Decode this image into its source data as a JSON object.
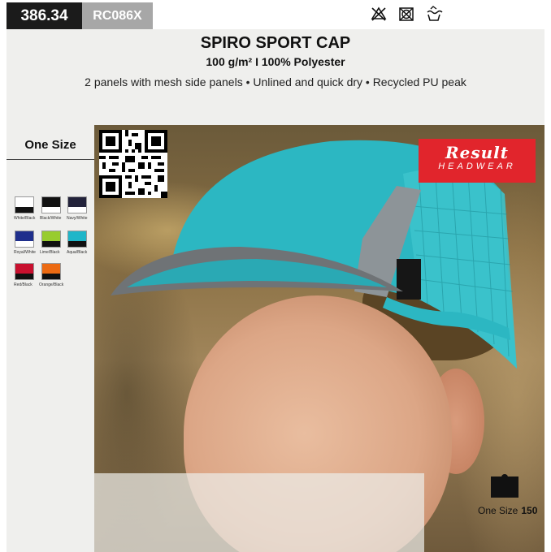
{
  "header": {
    "price": "386.34",
    "code": "RC086X",
    "care_icons": [
      "do-not-bleach-icon",
      "do-not-tumble-dry-icon",
      "hand-wash-icon"
    ]
  },
  "product": {
    "title": "SPIRO SPORT CAP",
    "subtitle": "100 g/m² I 100% Polyester",
    "description": "2 panels with mesh side panels • Unlined and quick dry • Recycled PU peak"
  },
  "sizes": {
    "label": "One Size",
    "table": {
      "size": "One Size",
      "value": "150"
    }
  },
  "colours": [
    {
      "name": "White/Black",
      "top": "#ffffff",
      "bottom": "#111111"
    },
    {
      "name": "Black/White",
      "top": "#111111",
      "bottom": "#ffffff"
    },
    {
      "name": "Navy/White",
      "top": "#22223a",
      "bottom": "#ffffff"
    },
    {
      "name": "Royal/White",
      "top": "#1f2f8c",
      "bottom": "#ffffff"
    },
    {
      "name": "Lime/Black",
      "top": "#98cc2f",
      "bottom": "#111111"
    },
    {
      "name": "Aqua/Black",
      "top": "#1fb6c9",
      "bottom": "#111111"
    },
    {
      "name": "Red/Black",
      "top": "#c8102e",
      "bottom": "#111111"
    },
    {
      "name": "Orange/Black",
      "top": "#ec6a12",
      "bottom": "#111111"
    }
  ],
  "brand": {
    "name": "Result",
    "sub": "HEADWEAR",
    "color": "#e1252c"
  },
  "cap_color": "#2cb7c2"
}
